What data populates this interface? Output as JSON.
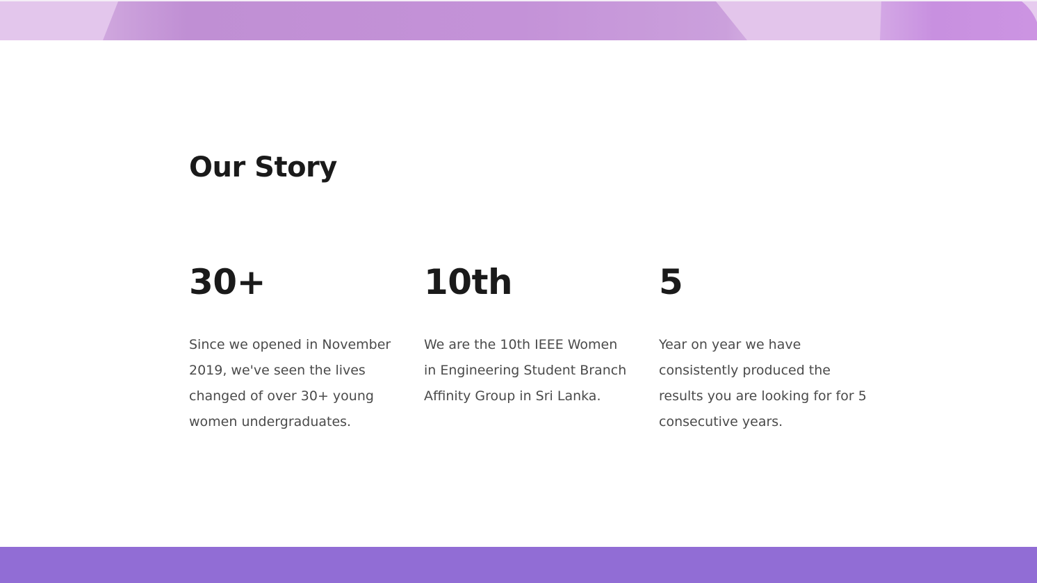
{
  "colors": {
    "banner_purple": "#c492d8",
    "footer_purple": "#916dd5",
    "heading": "#1a1a1a",
    "body_text": "#4a4a4a",
    "background": "#ffffff"
  },
  "story": {
    "title": "Our Story",
    "stats": [
      {
        "value": "30+",
        "text": "Since we opened in November 2019, we've seen the lives changed of over 30+ young women undergraduates."
      },
      {
        "value": "10th",
        "text": "We are the 10th IEEE Women in Engineering Student Branch Affinity Group in Sri Lanka."
      },
      {
        "value": "5",
        "text": "Year on year we have consistently produced the results you are looking for for 5 consecutive years."
      }
    ]
  }
}
